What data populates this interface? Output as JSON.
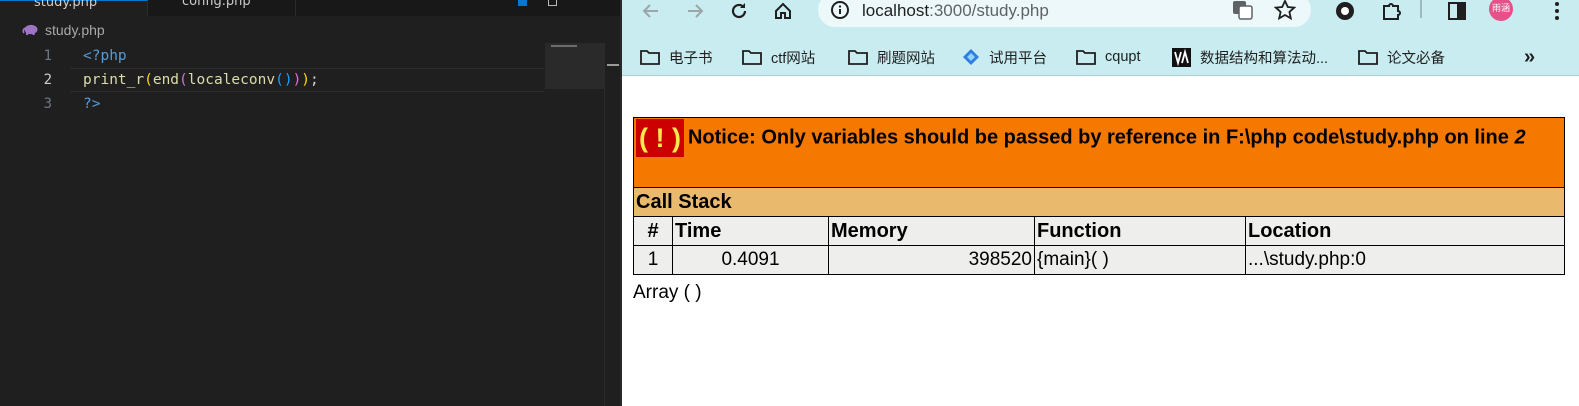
{
  "editor": {
    "tabs": [
      {
        "label": "study.php",
        "active": true
      },
      {
        "label": "config.php",
        "active": false
      }
    ],
    "breadcrumb": {
      "file": "study.php",
      "icon": "php-elephant-icon"
    },
    "lines": [
      {
        "number": "1",
        "tokens": [
          {
            "t": "<?php",
            "c": "kw-tag"
          }
        ]
      },
      {
        "number": "2",
        "tokens": [
          {
            "t": "print_r",
            "c": "fn"
          },
          {
            "t": "(",
            "c": "b1"
          },
          {
            "t": "end",
            "c": "fn"
          },
          {
            "t": "(",
            "c": "b2"
          },
          {
            "t": "localeconv",
            "c": "fn"
          },
          {
            "t": "()",
            "c": "b3"
          },
          {
            "t": ")",
            "c": "b2"
          },
          {
            "t": ")",
            "c": "b1"
          },
          {
            "t": ";",
            "c": "plain"
          }
        ]
      },
      {
        "number": "3",
        "tokens": [
          {
            "t": "?>",
            "c": "kw-tag"
          }
        ]
      }
    ]
  },
  "browser": {
    "url": {
      "host": "localhost",
      "path": ":3000/study.php"
    },
    "profile_label": "雨涵",
    "bookmarks": [
      {
        "label": "电子书",
        "icon": "folder-icon"
      },
      {
        "label": "ctf网站",
        "icon": "folder-icon"
      },
      {
        "label": "刷题网站",
        "icon": "folder-icon"
      },
      {
        "label": "试用平台",
        "icon": "platform-logo-icon"
      },
      {
        "label": "cqupt",
        "icon": "folder-icon"
      },
      {
        "label": "数据结构和算法动...",
        "icon": "va-logo-icon"
      },
      {
        "label": "论文必备",
        "icon": "folder-icon"
      }
    ],
    "more_label": "»"
  },
  "page": {
    "notice": {
      "bang": "( ! )",
      "message": "Notice: Only variables should be passed by reference in F:\\php code\\study.php on line ",
      "line": "2"
    },
    "call_stack_title": "Call Stack",
    "columns": [
      "#",
      "Time",
      "Memory",
      "Function",
      "Location"
    ],
    "rows": [
      {
        "num": "1",
        "time": "0.4091",
        "memory": "398520",
        "function": "{main}( )",
        "location": "...\\study.php:0"
      }
    ],
    "output": "Array ( )"
  },
  "colors": {
    "notice_bg": "#f57900",
    "bang_bg": "#cc0000",
    "bang_fg": "#fce94f",
    "callstack_bg": "#e9b96e",
    "table_cell_bg": "#eeeeec",
    "browser_chrome": "#c9ecf0",
    "editor_bg": "#1f1f1f"
  }
}
